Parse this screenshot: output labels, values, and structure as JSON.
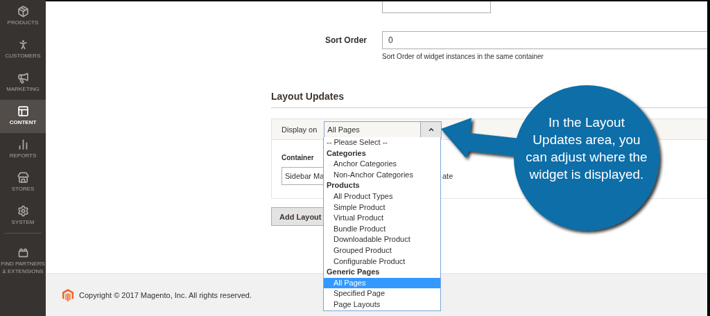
{
  "sidebar": {
    "items": [
      {
        "label": "PRODUCTS",
        "selected": false
      },
      {
        "label": "CUSTOMERS",
        "selected": false
      },
      {
        "label": "MARKETING",
        "selected": false
      },
      {
        "label": "CONTENT",
        "selected": true
      },
      {
        "label": "REPORTS",
        "selected": false
      },
      {
        "label": "STORES",
        "selected": false
      },
      {
        "label": "SYSTEM",
        "selected": false
      },
      {
        "label": "FIND PARTNERS & EXTENSIONS",
        "selected": false
      }
    ]
  },
  "form": {
    "sort_order": {
      "label": "Sort Order",
      "value": "0",
      "hint": "Sort Order of widget instances in the same container"
    }
  },
  "layout_updates": {
    "title": "Layout Updates",
    "display_on": {
      "label": "Display on",
      "value": "All Pages",
      "expanded": true
    },
    "container": {
      "label": "Container",
      "value": "Sidebar Ma",
      "column_2": "ate"
    },
    "add_button": "Add Layout"
  },
  "dropdown": {
    "placeholder": {
      "label": "-- Please Select --",
      "selected": false
    },
    "groups": [
      {
        "label": "Categories",
        "children": [
          {
            "label": "Anchor Categories",
            "selected": false
          },
          {
            "label": "Non-Anchor Categories",
            "selected": false
          }
        ]
      },
      {
        "label": "Products",
        "children": [
          {
            "label": "All Product Types",
            "selected": false
          },
          {
            "label": "Simple Product",
            "selected": false
          },
          {
            "label": "Virtual Product",
            "selected": false
          },
          {
            "label": "Bundle Product",
            "selected": false
          },
          {
            "label": "Downloadable Product",
            "selected": false
          },
          {
            "label": "Grouped Product",
            "selected": false
          },
          {
            "label": "Configurable Product",
            "selected": false
          }
        ]
      },
      {
        "label": "Generic Pages",
        "children": [
          {
            "label": "All Pages",
            "selected": true
          },
          {
            "label": "Specified Page",
            "selected": false
          },
          {
            "label": "Page Layouts",
            "selected": false
          }
        ]
      }
    ]
  },
  "callout": {
    "lines": [
      "In the Layout",
      "Updates area, you",
      "can adjust where the",
      "widget is displayed."
    ]
  },
  "footer": {
    "copyright": "Copyright © 2017 Magento, Inc. All rights reserved."
  }
}
